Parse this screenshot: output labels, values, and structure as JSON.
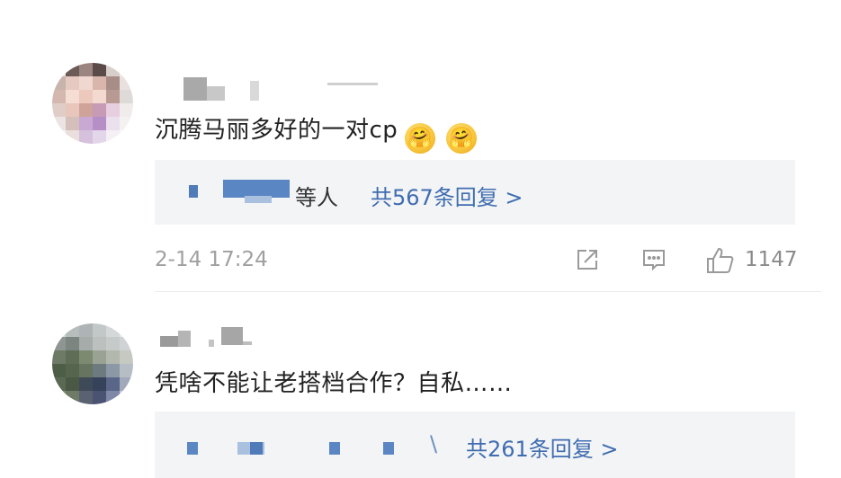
{
  "comments": [
    {
      "text": "沉腾马丽多好的一对cp",
      "emojis": [
        "🤗",
        "🤗"
      ],
      "reply_prefix": "等人",
      "reply_count_label": "共567条回复 >",
      "timestamp": "2-14 17:24",
      "like_count": "1147"
    },
    {
      "text": "凭啥不能让老搭档合作？自私……",
      "reply_prefix": "\\",
      "reply_count_label": "共261条回复 >"
    }
  ],
  "colors": {
    "link": "#3f6db0",
    "text": "#222222",
    "meta": "#a0a0a0",
    "reply_bg": "#f3f4f6"
  },
  "icons": {
    "share": "share-icon",
    "comment": "comment-icon",
    "like": "thumbs-up-icon"
  }
}
